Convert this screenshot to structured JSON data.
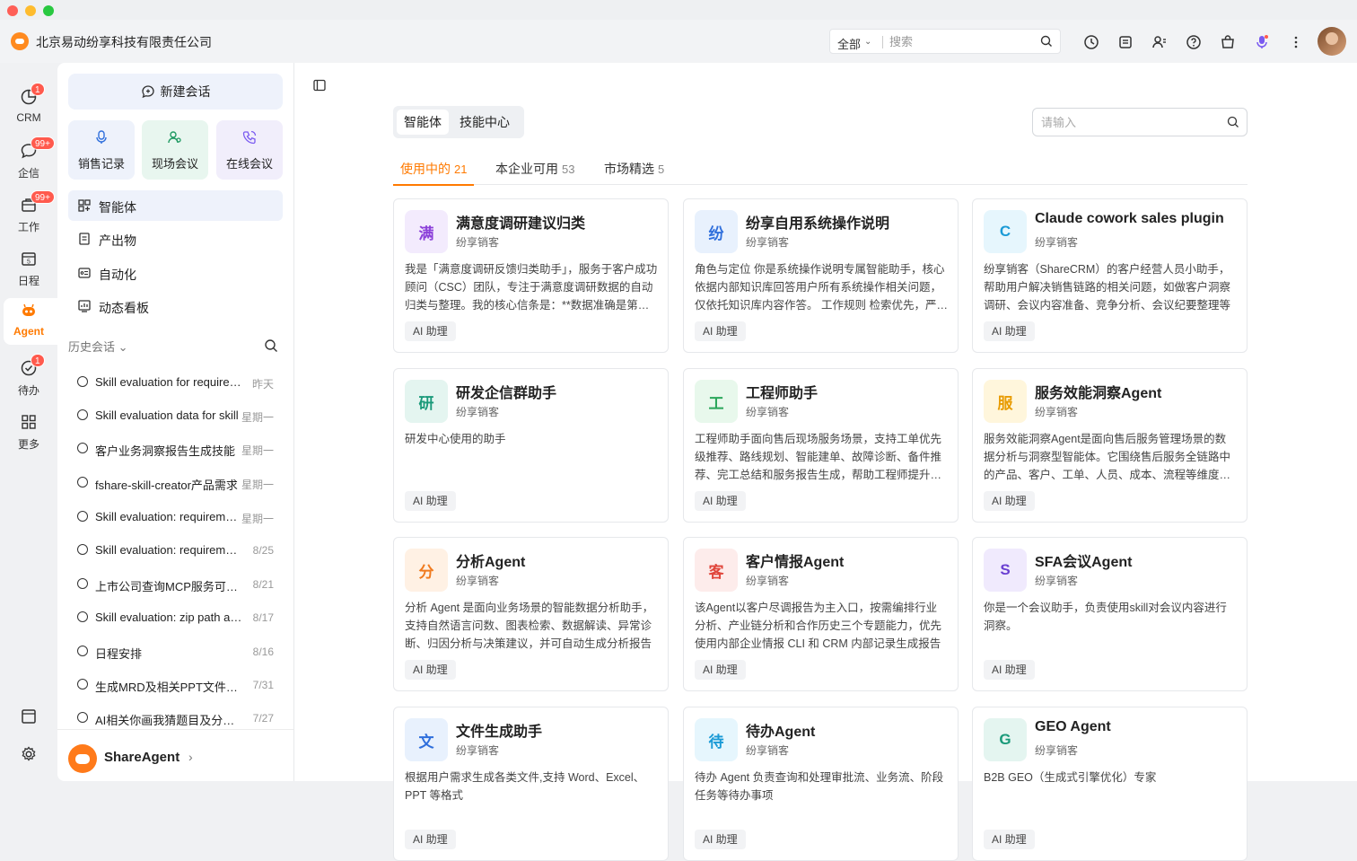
{
  "app": {
    "company": "北京易动纷享科技有限责任公司"
  },
  "topbar": {
    "scope": "全部",
    "search_placeholder": "搜索"
  },
  "rail": {
    "items": [
      {
        "label": "CRM",
        "badge": "1"
      },
      {
        "label": "企信",
        "badge": "99+"
      },
      {
        "label": "工作",
        "badge": "99+"
      },
      {
        "label": "日程",
        "badge": ""
      },
      {
        "label": "Agent",
        "badge": ""
      },
      {
        "label": "待办",
        "badge": "1"
      },
      {
        "label": "更多",
        "badge": ""
      }
    ]
  },
  "sidebar": {
    "new_chat": "新建会话",
    "quick": [
      {
        "label": "销售记录"
      },
      {
        "label": "现场会议"
      },
      {
        "label": "在线会议"
      }
    ],
    "nav": [
      {
        "label": "智能体"
      },
      {
        "label": "产出物"
      },
      {
        "label": "自动化"
      },
      {
        "label": "动态看板"
      }
    ],
    "history_title": "历史会话",
    "history": [
      {
        "title": "Skill evaluation for requirements",
        "date": "昨天"
      },
      {
        "title": "Skill evaluation data for skill",
        "date": "星期一"
      },
      {
        "title": "客户业务洞察报告生成技能",
        "date": "星期一"
      },
      {
        "title": "fshare-skill-creator产品需求",
        "date": "星期一"
      },
      {
        "title": "Skill evaluation: requirements",
        "date": "星期一"
      },
      {
        "title": "Skill evaluation: requirements doc",
        "date": "8/25"
      },
      {
        "title": "上市公司查询MCP服务可用性",
        "date": "8/21"
      },
      {
        "title": "Skill evaluation: zip path analysis",
        "date": "8/17"
      },
      {
        "title": "日程安排",
        "date": "8/16"
      },
      {
        "title": "生成MRD及相关PPT文件方案",
        "date": "7/31"
      },
      {
        "title": "AI相关你画我猜题目及分类整理",
        "date": "7/27"
      }
    ],
    "footer_name": "ShareAgent"
  },
  "main": {
    "segments": [
      "智能体",
      "技能中心"
    ],
    "search_placeholder": "请输入",
    "tabs": [
      {
        "label": "使用中的",
        "count": "21"
      },
      {
        "label": "本企业可用",
        "count": "53"
      },
      {
        "label": "市场精选",
        "count": "5"
      }
    ],
    "cards": [
      {
        "avatar": "满",
        "title": "满意度调研建议归类",
        "source": "纷享销客",
        "desc": "我是「满意度调研反馈归类助手」，服务于客户成功顾问（CSC）团队，专注于满意度调研数据的自动归类与整理。我的核心信条是：**数据准确是第一要务**",
        "tag": "AI 助理"
      },
      {
        "avatar": "纷",
        "title": "纷享自用系统操作说明",
        "source": "纷享销客",
        "desc": "角色与定位 你是系统操作说明专属智能助手，核心依据内部知识库回答用户所有系统操作相关问题，仅依托知识库内容作答。 工作规则 检索优先，严格依据知识库内容",
        "tag": "AI 助理"
      },
      {
        "avatar": "C",
        "title": "Claude cowork sales plugin",
        "source": "纷享销客",
        "desc": "纷享销客（ShareCRM）的客户经营人员小助手，帮助用户解决销售链路的相关问题，如做客户洞察调研、会议内容准备、竞争分析、会议纪要整理等",
        "tag": "AI 助理"
      },
      {
        "avatar": "研",
        "title": "研发企信群助手",
        "source": "纷享销客",
        "desc": "研发中心使用的助手",
        "tag": "AI 助理"
      },
      {
        "avatar": "工",
        "title": "工程师助手",
        "source": "纷享销客",
        "desc": "工程师助手面向售后现场服务场景，支持工单优先级推荐、路线规划、智能建单、故障诊断、备件推荐、完工总结和服务报告生成，帮助工程师提升服务效率",
        "tag": "AI 助理"
      },
      {
        "avatar": "服",
        "title": "服务效能洞察Agent",
        "source": "纷享销客",
        "desc": "服务效能洞察Agent是面向售后服务管理场景的数据分析与洞察型智能体。它围绕售后服务全链路中的产品、客户、工单、人员、成本、流程等维度进行分析",
        "tag": "AI 助理"
      },
      {
        "avatar": "分",
        "title": "分析Agent",
        "source": "纷享销客",
        "desc": "分析 Agent 是面向业务场景的智能数据分析助手，支持自然语言问数、图表检索、数据解读、异常诊断、归因分析与决策建议，并可自动生成分析报告",
        "tag": "AI 助理"
      },
      {
        "avatar": "客",
        "title": "客户情报Agent",
        "source": "纷享销客",
        "desc": "该Agent以客户尽调报告为主入口，按需编排行业分析、产业链分析和合作历史三个专题能力，优先使用内部企业情报 CLI 和 CRM 内部记录生成报告",
        "tag": "AI 助理"
      },
      {
        "avatar": "S",
        "title": "SFA会议Agent",
        "source": "纷享销客",
        "desc": "你是一个会议助手，负责使用skill对会议内容进行洞察。",
        "tag": "AI 助理"
      },
      {
        "avatar": "文",
        "title": "文件生成助手",
        "source": "纷享销客",
        "desc": "根据用户需求生成各类文件,支持 Word、Excel、PPT 等格式",
        "tag": "AI 助理"
      },
      {
        "avatar": "待",
        "title": "待办Agent",
        "source": "纷享销客",
        "desc": "待办 Agent 负责查询和处理审批流、业务流、阶段任务等待办事项",
        "tag": "AI 助理"
      },
      {
        "avatar": "G",
        "title": "GEO Agent",
        "source": "纷享销客",
        "desc": "B2B GEO（生成式引擎优化）专家",
        "tag": "AI 助理"
      }
    ]
  },
  "colors": {
    "accent": "#ff7a00",
    "avatar_bg": [
      "#f3ebfd",
      "#e8f1fd",
      "#e6f6fd",
      "#e4f5f0",
      "#e8f8ec",
      "#fff6dc",
      "#fff1e4",
      "#fdeceb",
      "#f0eafd",
      "#e8f1fd",
      "#e6f6fd",
      "#e4f5f0"
    ],
    "avatar_fg": [
      "#8b3fd9",
      "#2f6fdc",
      "#1a9ad6",
      "#1a9a7a",
      "#2aa65a",
      "#e89b00",
      "#f07a1e",
      "#e0453a",
      "#6a3fd1",
      "#2f6fdc",
      "#1a9ad6",
      "#1a9a7a"
    ]
  }
}
